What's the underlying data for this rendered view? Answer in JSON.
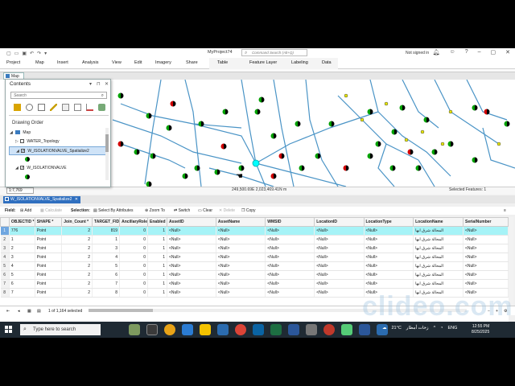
{
  "titlebar": {
    "project_title": "MyProject74",
    "command_search_placeholder": "Command Search (Alt+Q)",
    "signin": "Not signed in"
  },
  "ribbon": {
    "tabs": [
      "Project",
      "Map",
      "Insert",
      "Analysis",
      "View",
      "Edit",
      "Imagery",
      "Share",
      "Table",
      "Feature Layer",
      "Labeling",
      "Data"
    ]
  },
  "map_tab": "Map",
  "contents": {
    "title": "Contents",
    "search_placeholder": "Search",
    "section": "Drawing Order",
    "items": [
      {
        "label": "Map",
        "level": 0
      },
      {
        "label": "WATER_Topology",
        "level": 1
      },
      {
        "label": "W_ISOLATIONVALVE_Spatialize2",
        "level": 1,
        "checked": true,
        "selected": true
      },
      {
        "label": "W_ISOLATIONVALVE",
        "level": 1,
        "checked": true
      }
    ]
  },
  "map_status": {
    "scale": "1:7,769",
    "coords": "249,500.69E 2,023,469.41N m",
    "selected": "Selected Features: 1"
  },
  "table_tab": "W_ISOLATIONVALVE_Spatialize2",
  "toolbar": {
    "field": "Field:",
    "add": "Add",
    "calculate": "Calculate",
    "selection": "Selection:",
    "select_by_attributes": "Select By Attributes",
    "zoom_to": "Zoom To",
    "switch": "Switch",
    "clear": "Clear",
    "delete": "Delete",
    "copy": "Copy"
  },
  "table": {
    "columns": [
      "OBJECTID *",
      "SHAPE *",
      "Join_Count *",
      "TARGET_FID",
      "AncillaryRole",
      "Enabled",
      "AssetID",
      "AssetName",
      "WMSID",
      "LocationID",
      "LocationType",
      "LocationName",
      "SerialNumber"
    ],
    "rows": [
      [
        "776",
        "Point",
        "2",
        "819",
        "0",
        "1",
        "<Null>",
        "<Null>",
        "<Null>",
        "<Null>",
        "<Null>",
        "المحالة شرق ابها",
        "<Null>"
      ],
      [
        "1",
        "Point",
        "2",
        "1",
        "0",
        "1",
        "<Null>",
        "<Null>",
        "<Null>",
        "<Null>",
        "<Null>",
        "المحالة شرق ابها",
        "<Null>"
      ],
      [
        "2",
        "Point",
        "2",
        "3",
        "0",
        "1",
        "<Null>",
        "<Null>",
        "<Null>",
        "<Null>",
        "<Null>",
        "المحالة شرق ابها",
        "<Null>"
      ],
      [
        "3",
        "Point",
        "2",
        "4",
        "0",
        "1",
        "<Null>",
        "<Null>",
        "<Null>",
        "<Null>",
        "<Null>",
        "المحالة شرق ابها",
        "<Null>"
      ],
      [
        "4",
        "Point",
        "2",
        "5",
        "0",
        "1",
        "<Null>",
        "<Null>",
        "<Null>",
        "<Null>",
        "<Null>",
        "المحالة شرق ابها",
        "<Null>"
      ],
      [
        "5",
        "Point",
        "2",
        "6",
        "0",
        "1",
        "<Null>",
        "<Null>",
        "<Null>",
        "<Null>",
        "<Null>",
        "المحالة شرق ابها",
        "<Null>"
      ],
      [
        "6",
        "Point",
        "2",
        "7",
        "0",
        "1",
        "<Null>",
        "<Null>",
        "<Null>",
        "<Null>",
        "<Null>",
        "المحالة شرق ابها",
        "<Null>"
      ],
      [
        "7",
        "Point",
        "2",
        "8",
        "0",
        "1",
        "<Null>",
        "<Null>",
        "<Null>",
        "<Null>",
        "<Null>",
        "المحالة شرق ابها",
        "<Null>"
      ]
    ],
    "row_numbers": [
      "1",
      "2",
      "3",
      "4",
      "5",
      "6",
      "7",
      "8"
    ]
  },
  "table_status": {
    "selected": "1 of 1,164 selected"
  },
  "watermark": "clideo.com",
  "taskbar": {
    "search": "Type here to search",
    "temp": "21°C",
    "weather": "زخات أمطار",
    "lang": "ENG",
    "time": "12:55 PM",
    "date": "8/25/2025"
  },
  "colors": {
    "pipe": "#4a94c6",
    "valve_green": "#00a000",
    "valve_red": "#d00000",
    "node_yellow": "#e8e800",
    "selection_cyan": "#00ffff",
    "table_tab": "#2f6fbf"
  }
}
